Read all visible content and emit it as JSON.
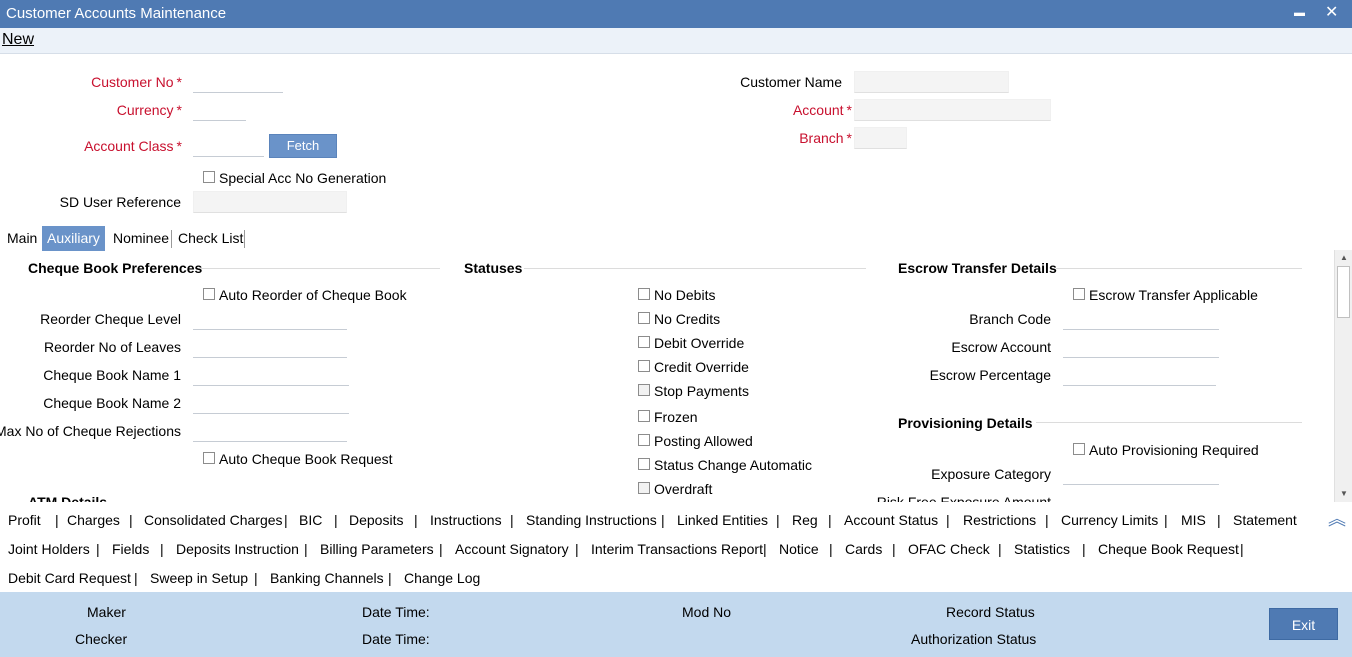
{
  "window": {
    "title": "Customer Accounts Maintenance",
    "minimize": "▬",
    "close": "✕"
  },
  "toolbar": {
    "new": "New"
  },
  "header": {
    "customer_no": {
      "label": "Customer No",
      "required": "*",
      "value": ""
    },
    "currency": {
      "label": "Currency",
      "required": "*",
      "value": ""
    },
    "account_class": {
      "label": "Account Class",
      "required": "*",
      "value": ""
    },
    "fetch": "Fetch",
    "special_acc": "Special Acc No Generation",
    "sd_user_ref": {
      "label": "SD User Reference",
      "value": ""
    },
    "customer_name": {
      "label": "Customer Name",
      "value": ""
    },
    "account": {
      "label": "Account",
      "required": "*",
      "value": ""
    },
    "branch": {
      "label": "Branch",
      "required": "*",
      "value": ""
    }
  },
  "tabs": [
    "Main",
    "Auxiliary",
    "Nominee",
    "Check List"
  ],
  "cheque": {
    "title": "Cheque Book Preferences",
    "auto_reorder": "Auto Reorder of Cheque Book",
    "reorder_level": "Reorder Cheque Level",
    "reorder_leaves": "Reorder No of Leaves",
    "name1": "Cheque Book Name 1",
    "name2": "Cheque Book Name 2",
    "max_rejections": "Max No of Cheque Rejections",
    "auto_request": "Auto Cheque Book Request",
    "atm": "ATM Details"
  },
  "statuses": {
    "title": "Statuses",
    "items": [
      "No Debits",
      "No Credits",
      "Debit Override",
      "Credit Override",
      "Stop Payments",
      "Frozen",
      "Posting Allowed",
      "Status Change Automatic",
      "Overdraft"
    ]
  },
  "escrow": {
    "title": "Escrow Transfer Details",
    "applicable": "Escrow Transfer Applicable",
    "branch_code": "Branch Code",
    "account": "Escrow Account",
    "percentage": "Escrow Percentage"
  },
  "provisioning": {
    "title": "Provisioning Details",
    "auto": "Auto Provisioning Required",
    "exposure": "Exposure Category",
    "risk_free": "Risk Free Exposure Amount"
  },
  "links": {
    "row1": [
      "Profit",
      "Charges",
      "Consolidated Charges",
      "BIC",
      "Deposits",
      "Instructions",
      "Standing Instructions",
      "Linked Entities",
      "Reg",
      "Account Status",
      "Restrictions",
      "Currency Limits",
      "MIS",
      "Statement"
    ],
    "row2": [
      "Joint Holders",
      "Fields",
      "Deposits Instruction",
      "Billing Parameters",
      "Account Signatory",
      "Interim Transactions Report",
      "Notice",
      "Cards",
      "OFAC Check",
      "Statistics",
      "Cheque Book Request"
    ],
    "row3": [
      "Debit Card Request",
      "Sweep in Setup",
      "Banking Channels",
      "Change Log"
    ],
    "collapse": "︽"
  },
  "footer": {
    "maker": "Maker",
    "checker": "Checker",
    "date_time_1": "Date Time:",
    "date_time_2": "Date Time:",
    "mod_no": "Mod No",
    "record_status": "Record Status",
    "auth_status": "Authorization Status",
    "exit": "Exit"
  }
}
